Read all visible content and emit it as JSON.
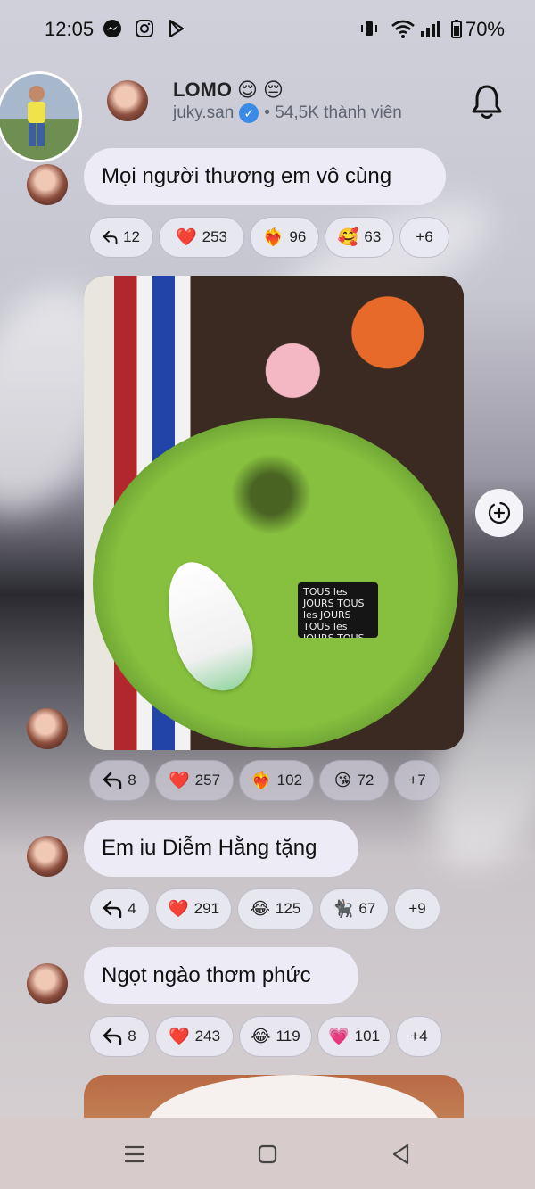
{
  "status_bar": {
    "time": "12:05",
    "battery": "70%",
    "icons": [
      "messenger-icon",
      "instagram-icon",
      "play-store-icon",
      "vibrate-icon",
      "wifi-icon",
      "signal-icon",
      "battery-icon"
    ]
  },
  "header": {
    "title": "LOMO",
    "title_emojis": "😌 😔",
    "username": "juky.san",
    "members": "• 54,5K thành viên"
  },
  "messages": [
    {
      "text": "Mọi người thương em vô cùng",
      "reactions": {
        "reply": "12",
        "items": [
          {
            "emoji": "❤️",
            "count": "253"
          },
          {
            "emoji": "❤️‍🔥",
            "count": "96"
          },
          {
            "emoji": "🥰",
            "count": "63"
          }
        ],
        "more": "+6"
      }
    },
    {
      "photo": {
        "tag_text": "TOUS les JOURS TOUS les JOURS TOUS les JOURS TOUS les JOURS"
      },
      "reactions": {
        "reply": "8",
        "items": [
          {
            "emoji": "❤️",
            "count": "257"
          },
          {
            "emoji": "❤️‍🔥",
            "count": "102"
          },
          {
            "emoji": "😘",
            "count": "72"
          }
        ],
        "more": "+7"
      }
    },
    {
      "text": "Em iu Diễm Hằng tặng",
      "reactions": {
        "reply": "4",
        "items": [
          {
            "emoji": "❤️",
            "count": "291"
          },
          {
            "emoji": "😂",
            "count": "125"
          },
          {
            "emoji": "🐈‍⬛",
            "count": "67"
          }
        ],
        "more": "+9"
      }
    },
    {
      "text": "Ngọt ngào thơm phức",
      "reactions": {
        "reply": "8",
        "items": [
          {
            "emoji": "❤️",
            "count": "243"
          },
          {
            "emoji": "😂",
            "count": "119"
          },
          {
            "emoji": "💗",
            "count": "101"
          }
        ],
        "more": "+4"
      }
    }
  ],
  "nav": [
    "menu-icon",
    "home-icon",
    "back-icon"
  ]
}
